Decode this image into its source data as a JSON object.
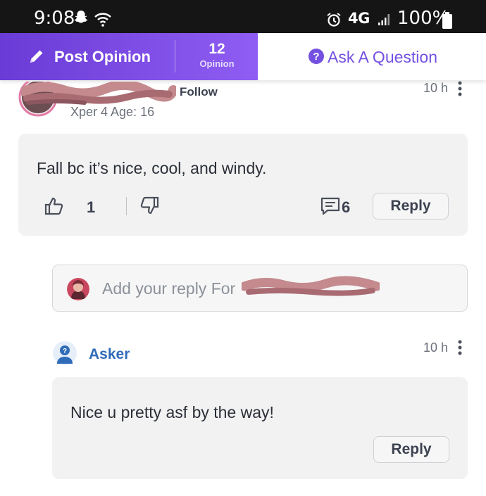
{
  "status_bar": {
    "time": "9:08",
    "network": "4G",
    "battery": "100%",
    "icons": [
      "snapchat-icon",
      "wifi-icon",
      "alarm-icon",
      "signal-icon",
      "battery-icon"
    ]
  },
  "action_bar": {
    "post_label": "Post Opinion",
    "opinion_count": "12",
    "opinion_count_label": "Opinion",
    "ask_label": "Ask A Question",
    "accent": "#7450e0"
  },
  "opinion": {
    "follow_label": "Follow",
    "xper_info": "Xper 4 Age: 16",
    "time": "10 h",
    "text": "Fall bc it’s nice, cool, and windy.",
    "like_count": "1",
    "comment_count": "6",
    "reply_label": "Reply"
  },
  "reply_input": {
    "placeholder": "Add your reply For"
  },
  "asker_reply": {
    "name": "Asker",
    "time": "10 h",
    "text": "Nice u pretty asf by the way!",
    "reply_label": "Reply",
    "name_color": "#2f6bb8"
  }
}
